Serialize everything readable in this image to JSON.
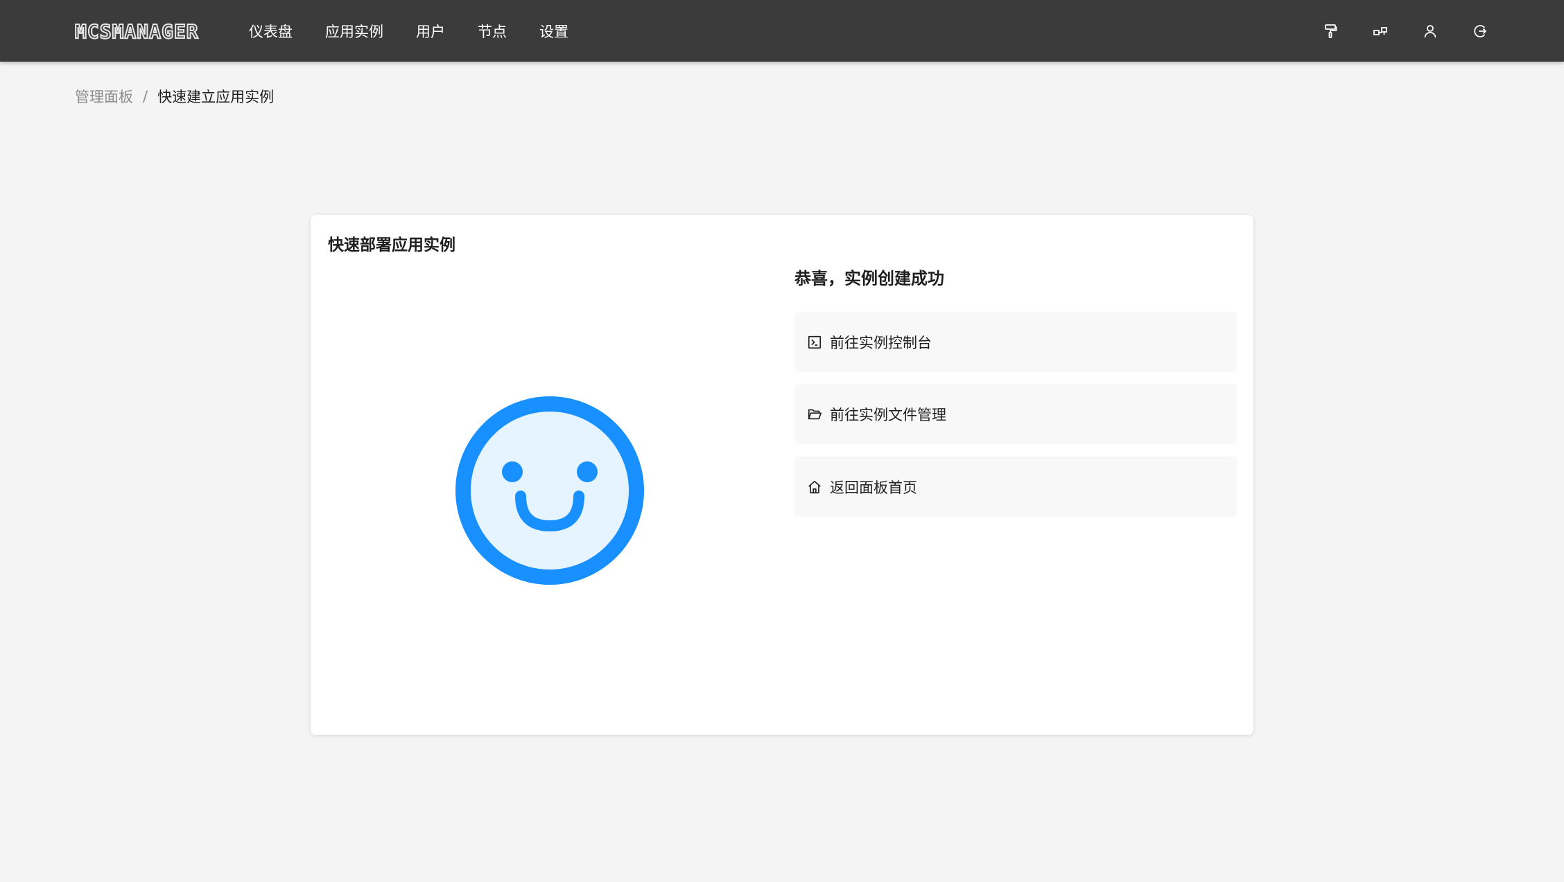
{
  "header": {
    "logo": "MCSMANAGER",
    "nav": [
      "仪表盘",
      "应用实例",
      "用户",
      "节点",
      "设置"
    ],
    "icons": [
      "paint-roller-icon",
      "cluster-icon",
      "user-icon",
      "logout-icon"
    ]
  },
  "breadcrumb": {
    "root": "管理面板",
    "separator": "/",
    "current": "快速建立应用实例"
  },
  "card": {
    "title": "快速部署应用实例",
    "success_title": "恭喜，实例创建成功",
    "actions": [
      {
        "label": "前往实例控制台",
        "icon": "terminal-icon"
      },
      {
        "label": "前往实例文件管理",
        "icon": "folder-open-icon"
      },
      {
        "label": "返回面板首页",
        "icon": "home-icon"
      }
    ]
  },
  "colors": {
    "topbar": "#3b3b3b",
    "accent": "#1890ff",
    "smiley_fill": "#e6f4ff",
    "page_bg": "#f4f4f4"
  }
}
